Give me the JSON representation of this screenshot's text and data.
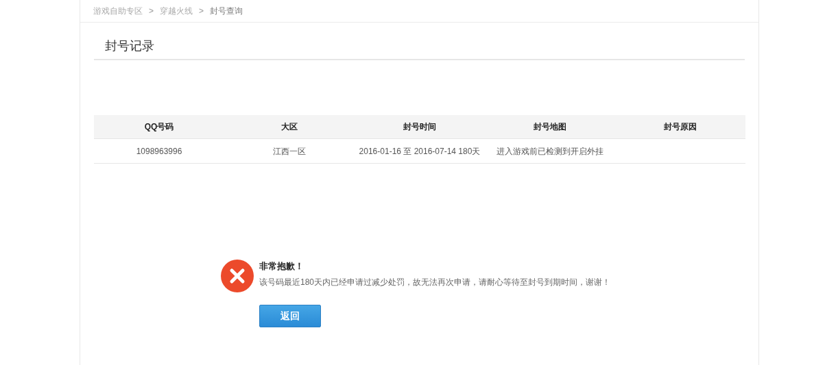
{
  "breadcrumb": [
    {
      "label": "游戏自助专区"
    },
    {
      "label": "穿越火线"
    },
    {
      "label": "封号查询"
    }
  ],
  "breadcrumb_separator": ">",
  "section_title": "封号记录",
  "table": {
    "columns": [
      "QQ号码",
      "大区",
      "封号时间",
      "封号地图",
      "封号原因"
    ],
    "rows": [
      [
        "1098963996",
        "江西一区",
        "2016-01-16 至 2016-07-14 180天",
        "进入游戏前已检测到开启外挂",
        ""
      ]
    ]
  },
  "message": {
    "kind": "error",
    "title": "非常抱歉！",
    "text": "该号码最近180天内已经申请过减少处罚，故无法再次申请，请耐心等待至封号到期时间，谢谢！",
    "button": "返回"
  }
}
